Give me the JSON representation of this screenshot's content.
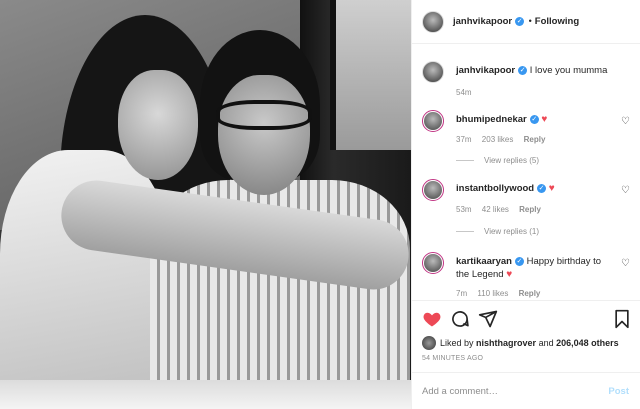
{
  "post": {
    "author": "janhvikapoor",
    "follow_status": "Following",
    "caption": "I love you mumma",
    "caption_time": "54m"
  },
  "comments": [
    {
      "user": "bhumipednekar",
      "text": "",
      "emoji": "heart",
      "time": "37m",
      "likes": "203 likes",
      "reply": "Reply",
      "view_replies": "View replies (5)"
    },
    {
      "user": "instantbollywood",
      "text": "",
      "emoji": "heart",
      "time": "53m",
      "likes": "42 likes",
      "reply": "Reply",
      "view_replies": "View replies (1)"
    },
    {
      "user": "kartikaaryan",
      "text": "Happy birthday to the Legend",
      "emoji": "heart",
      "time": "7m",
      "likes": "110 likes",
      "reply": "Reply"
    }
  ],
  "liked_by": {
    "prefix": "Liked by",
    "user": "nishthagrover",
    "and": "and",
    "others": "206,048 others"
  },
  "post_time": "54 MINUTES AGO",
  "add_comment": {
    "placeholder": "Add a comment…",
    "post_label": "Post"
  },
  "colors": {
    "accent": "#3897f0",
    "like_red": "#ed4956",
    "post_disabled": "#b2dffc"
  }
}
